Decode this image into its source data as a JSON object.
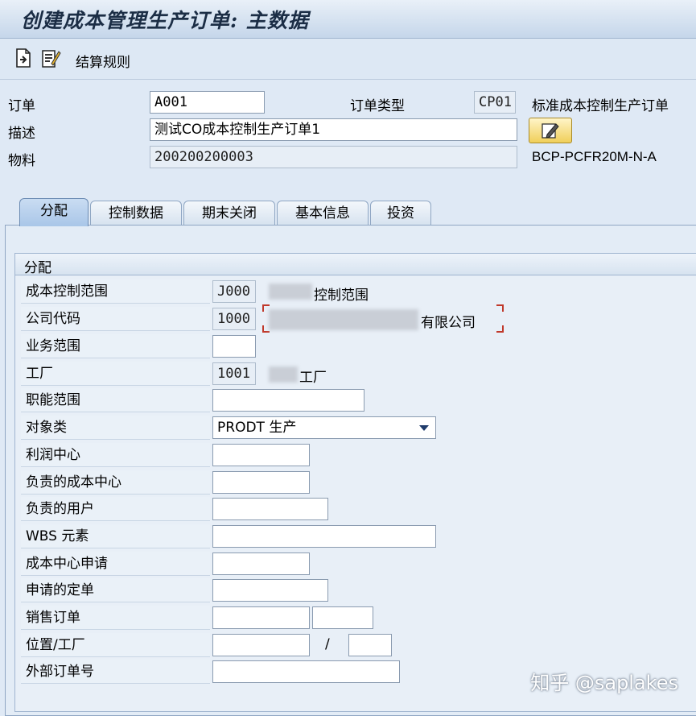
{
  "window": {
    "title": "创建成本管理生产订单: 主数据"
  },
  "toolbar": {
    "settlement_rule_label": "结算规则",
    "icons": [
      "new-document-icon",
      "settlement-icon"
    ]
  },
  "header": {
    "order_label": "订单",
    "order_value": "A001",
    "order_type_label": "订单类型",
    "order_type_value": "CP01",
    "order_type_text": "标准成本控制生产订单",
    "description_label": "描述",
    "description_value": "测试CO成本控制生产订单1",
    "material_label": "物料",
    "material_value": "200200200003",
    "material_text": "BCP-PCFR20M-N-A"
  },
  "tabs": [
    {
      "label": "分配",
      "active": true
    },
    {
      "label": "控制数据",
      "active": false
    },
    {
      "label": "期末关闭",
      "active": false
    },
    {
      "label": "基本信息",
      "active": false
    },
    {
      "label": "投资",
      "active": false
    }
  ],
  "assignment": {
    "group_title": "分配",
    "controlling_area_label": "成本控制范围",
    "controlling_area_value": "J000",
    "controlling_area_text": "控制范围",
    "company_code_label": "公司代码",
    "company_code_value": "1000",
    "company_code_text": "有限公司",
    "business_area_label": "业务范围",
    "business_area_value": "",
    "plant_label": "工厂",
    "plant_value": "1001",
    "plant_text": "工厂",
    "functional_area_label": "职能范围",
    "functional_area_value": "",
    "object_class_label": "对象类",
    "object_class_value": "PRODT 生产",
    "profit_center_label": "利润中心",
    "profit_center_value": "",
    "responsible_cc_label": "负责的成本中心",
    "responsible_cc_value": "",
    "responsible_user_label": "负责的用户",
    "responsible_user_value": "",
    "wbs_label": "WBS 元素",
    "wbs_value": "",
    "requesting_cc_label": "成本中心申请",
    "requesting_cc_value": "",
    "requesting_order_label": "申请的定单",
    "requesting_order_value": "",
    "sales_order_label": "销售订单",
    "sales_order_value": "",
    "sales_order_item_value": "",
    "location_plant_label": "位置/工厂",
    "location_value": "",
    "location_separator": "/",
    "location_plant_value": "",
    "external_order_label": "外部订单号",
    "external_order_value": ""
  },
  "watermark": "知乎 @saplakes",
  "colors": {
    "title_bar": "#c5d6ea",
    "panel": "#e3ecf6",
    "active_tab": "#a9c6e8"
  }
}
